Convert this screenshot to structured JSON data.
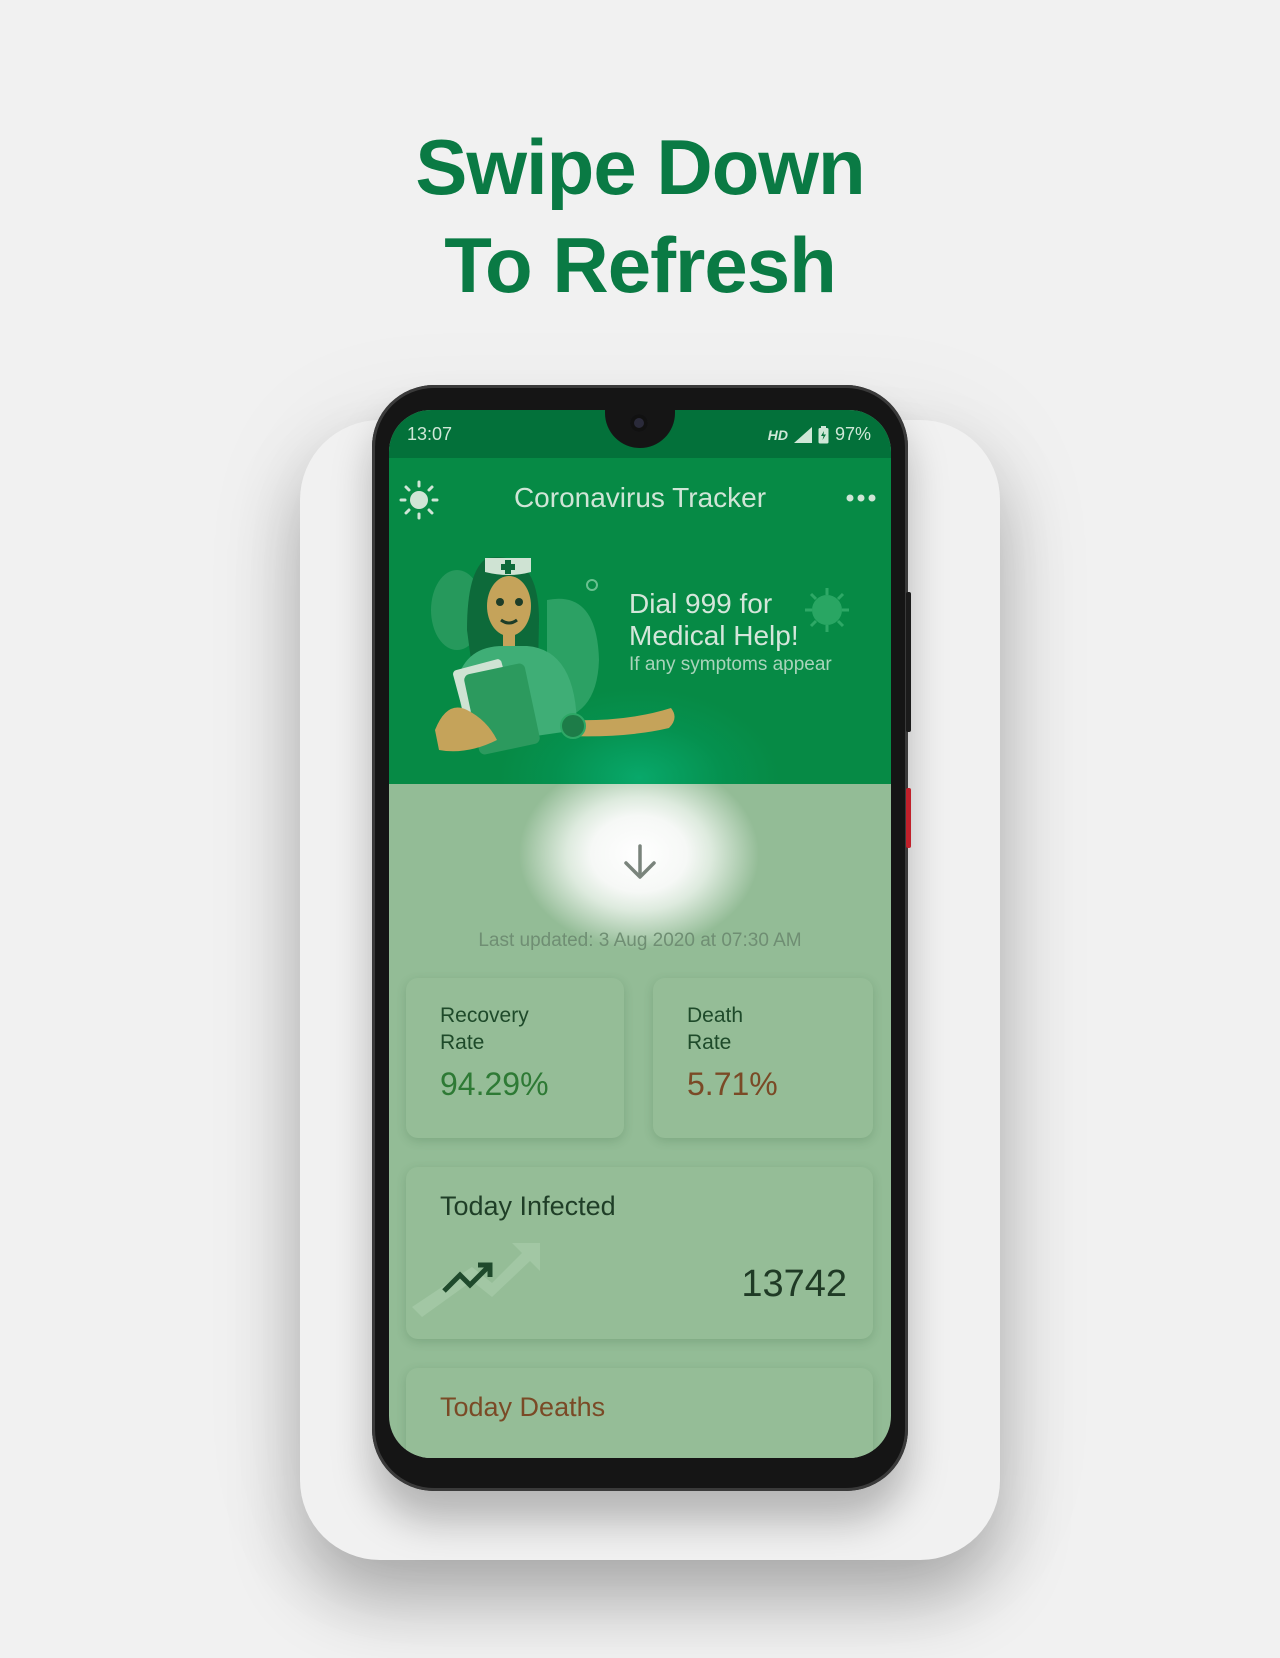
{
  "headline": {
    "line1": "Swipe Down",
    "line2": "To Refresh"
  },
  "status_bar": {
    "time": "13:07",
    "network": "HD",
    "battery": "97%"
  },
  "app_bar": {
    "title": "Coronavirus Tracker",
    "theme_icon": "sun-icon",
    "menu_icon": "more-horizontal-icon"
  },
  "banner": {
    "title_line1": "Dial 999 for",
    "title_line2": "Medical Help!",
    "subtitle": "If any symptoms appear"
  },
  "refresh": {
    "icon": "arrow-down-icon",
    "last_updated": "Last updated: 3 Aug 2020 at 07:30 AM"
  },
  "rates": {
    "recovery": {
      "label_line1": "Recovery",
      "label_line2": "Rate",
      "value": "94.29%",
      "color": "#2e7a35"
    },
    "death": {
      "label_line1": "Death",
      "label_line2": "Rate",
      "value": "5.71%",
      "color": "#7a4a26"
    }
  },
  "today_infected": {
    "label": "Today Infected",
    "value": "13742",
    "icon": "trending-up-icon"
  },
  "today_deaths": {
    "label": "Today Deaths",
    "color": "#7a4a26"
  },
  "colors": {
    "brand_green": "#0a7a44",
    "appbar_green": "#05914f",
    "overlay": "#93bc96"
  }
}
